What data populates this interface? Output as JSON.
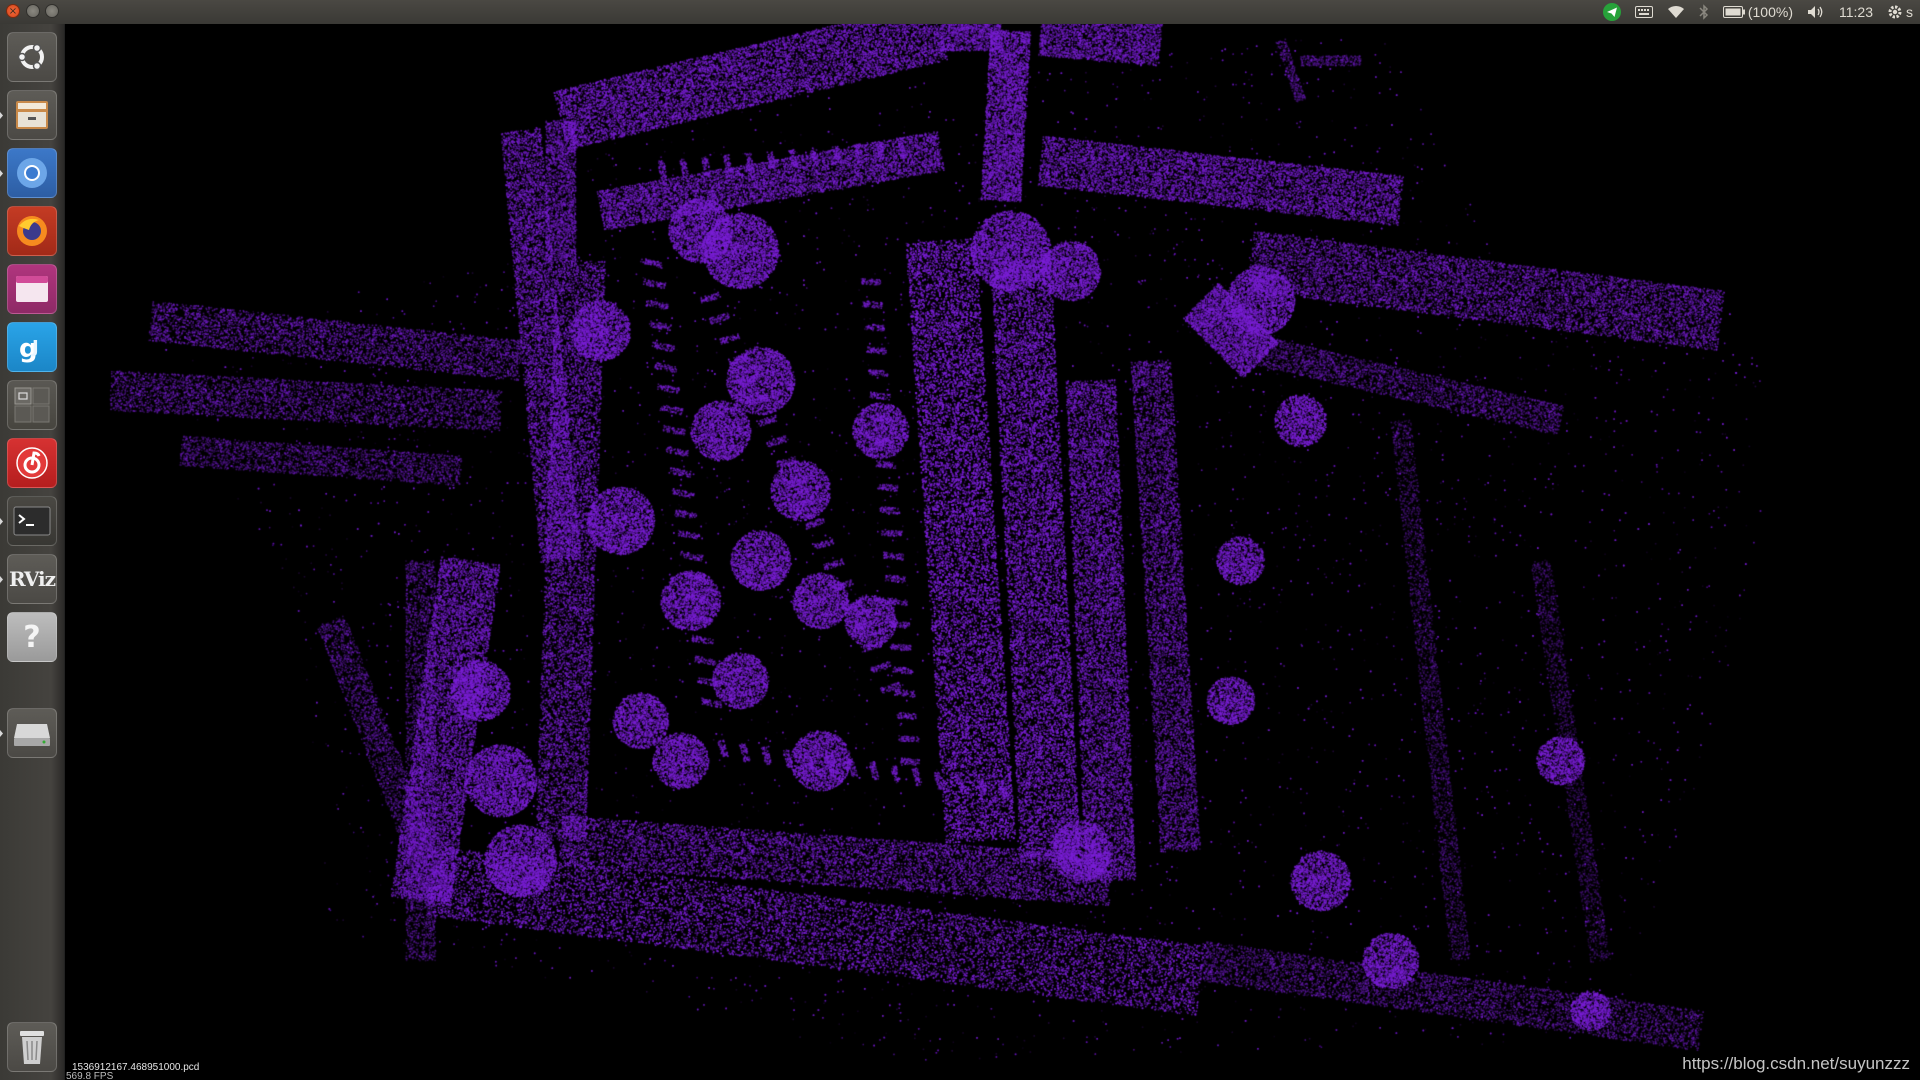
{
  "top_panel": {
    "battery": "(100%)",
    "clock": "11:23",
    "session_glyph": "s"
  },
  "launcher": {
    "items": [
      {
        "name": "ubuntu-dash",
        "icon": "ubuntu-logo-icon"
      },
      {
        "name": "files",
        "icon": "file-cabinet-icon"
      },
      {
        "name": "chromium",
        "icon": "chromium-icon"
      },
      {
        "name": "firefox",
        "icon": "firefox-icon"
      },
      {
        "name": "app-window",
        "icon": "pink-window-icon"
      },
      {
        "name": "qq-pinyin",
        "icon": "input-method-icon"
      },
      {
        "name": "workspace-switcher",
        "icon": "workspace-icon"
      },
      {
        "name": "netease-music",
        "icon": "music-icon"
      },
      {
        "name": "terminal",
        "icon": "terminal-icon"
      },
      {
        "name": "rviz",
        "icon": "rviz-icon"
      },
      {
        "name": "help",
        "icon": "help-icon"
      },
      {
        "name": "drive",
        "icon": "hard-drive-icon"
      },
      {
        "name": "trash",
        "icon": "trash-icon"
      }
    ],
    "rviz_label": "RViz",
    "help_glyph": "?"
  },
  "viewer": {
    "pcd_filename": "1536912167.468951000.pcd",
    "fps": "569.8 FPS",
    "point_color": "#7a1fd6",
    "background_color": "#000000",
    "watermark": "https://blog.csdn.net/suyunzzz"
  }
}
